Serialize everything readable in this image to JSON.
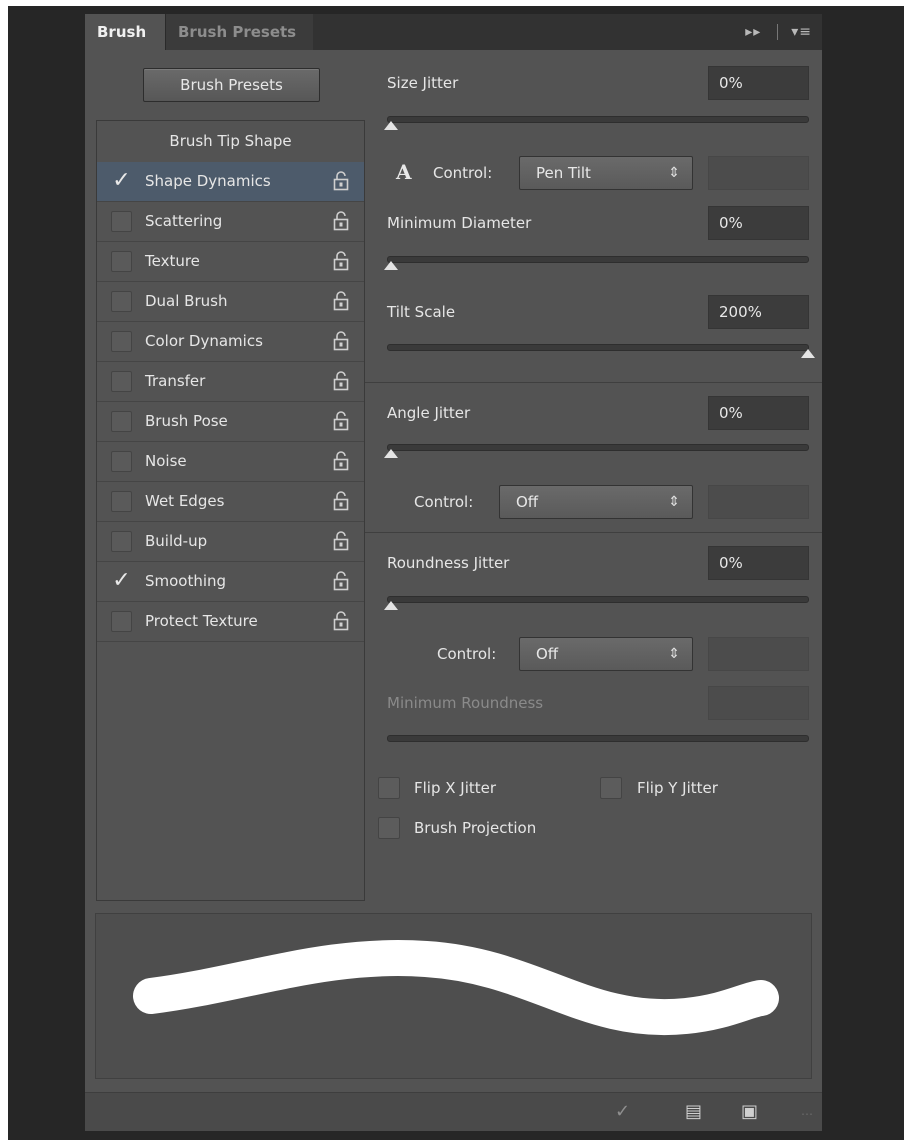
{
  "tabs": {
    "active": "Brush",
    "inactive": "Brush Presets"
  },
  "tabbar_icons": {
    "collapse": "collapse-double-arrow-icon",
    "menu": "panel-menu-icon"
  },
  "presets_button": "Brush Presets",
  "list": {
    "header": "Brush Tip Shape",
    "items": [
      {
        "label": "Shape Dynamics",
        "checked": true,
        "selected": true
      },
      {
        "label": "Scattering",
        "checked": false
      },
      {
        "label": "Texture",
        "checked": false
      },
      {
        "label": "Dual Brush",
        "checked": false
      },
      {
        "label": "Color Dynamics",
        "checked": false
      },
      {
        "label": "Transfer",
        "checked": false
      },
      {
        "label": "Brush Pose",
        "checked": false
      },
      {
        "label": "Noise",
        "checked": false
      },
      {
        "label": "Wet Edges",
        "checked": false
      },
      {
        "label": "Build-up",
        "checked": false
      },
      {
        "label": "Smoothing",
        "checked": true
      },
      {
        "label": "Protect Texture",
        "checked": false
      }
    ]
  },
  "settings": {
    "size_jitter": {
      "label": "Size Jitter",
      "value": "0%"
    },
    "size_control": {
      "label": "Control:",
      "value": "Pen Tilt"
    },
    "min_diameter": {
      "label": "Minimum Diameter",
      "value": "0%"
    },
    "tilt_scale": {
      "label": "Tilt Scale",
      "value": "200%"
    },
    "angle_jitter": {
      "label": "Angle Jitter",
      "value": "0%"
    },
    "angle_control": {
      "label": "Control:",
      "value": "Off"
    },
    "roundness_jitter": {
      "label": "Roundness Jitter",
      "value": "0%"
    },
    "roundness_control": {
      "label": "Control:",
      "value": "Off"
    },
    "min_roundness": {
      "label": "Minimum Roundness",
      "value": ""
    },
    "flip_x": "Flip X Jitter",
    "flip_y": "Flip Y Jitter",
    "brush_projection": "Brush Projection"
  }
}
